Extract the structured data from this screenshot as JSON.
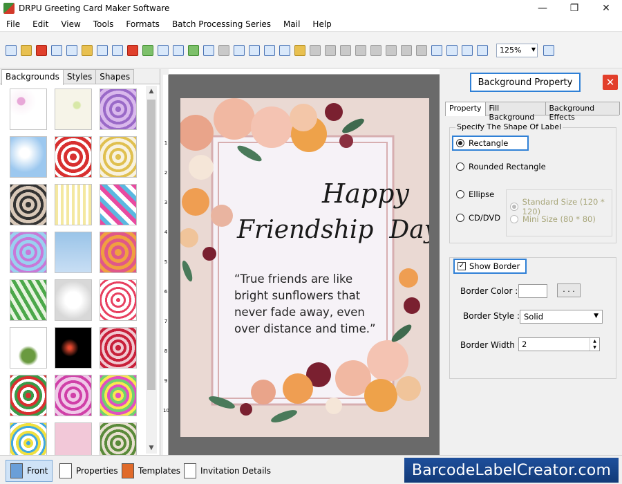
{
  "window": {
    "title": "DRPU Greeting Card Maker Software",
    "controls": [
      "—",
      "❐",
      "✕"
    ]
  },
  "menu": [
    "File",
    "Edit",
    "View",
    "Tools",
    "Formats",
    "Batch Processing Series",
    "Mail",
    "Help"
  ],
  "toolbar": {
    "zoom": "125%"
  },
  "left_panel": {
    "tabs": [
      "Backgrounds",
      "Styles",
      "Shapes"
    ],
    "active_tab": "Backgrounds"
  },
  "ruler": {
    "marks": [
      "1",
      "2",
      "3",
      "4",
      "5",
      "6",
      "7",
      "8",
      "9",
      "10"
    ]
  },
  "card": {
    "line1": "Happy",
    "line2": "Friendship  Day",
    "quote": "“True friends are like bright sunflowers that never fade away, even over distance and time.”"
  },
  "right_panel": {
    "title": "Background Property",
    "tabs": [
      "Property",
      "Fill Background",
      "Background Effects"
    ],
    "shape_group": "Specify The Shape Of Label",
    "shapes": [
      "Rectangle",
      "Rounded Rectangle",
      "Ellipse",
      "CD/DVD"
    ],
    "selected_shape": "Rectangle",
    "sizes": [
      "Standard Size (120 * 120)",
      "Mini Size (80 * 80)"
    ],
    "show_border": "Show Border",
    "border_color_label": "Border Color :",
    "border_color_btn": ". . .",
    "border_style_label": "Border Style :",
    "border_style": "Solid",
    "border_width_label": "Border Width :",
    "border_width": "2"
  },
  "bottom_tabs": [
    "Front",
    "Properties",
    "Templates",
    "Invitation Details"
  ],
  "brand": "BarcodeLabelCreator.com"
}
